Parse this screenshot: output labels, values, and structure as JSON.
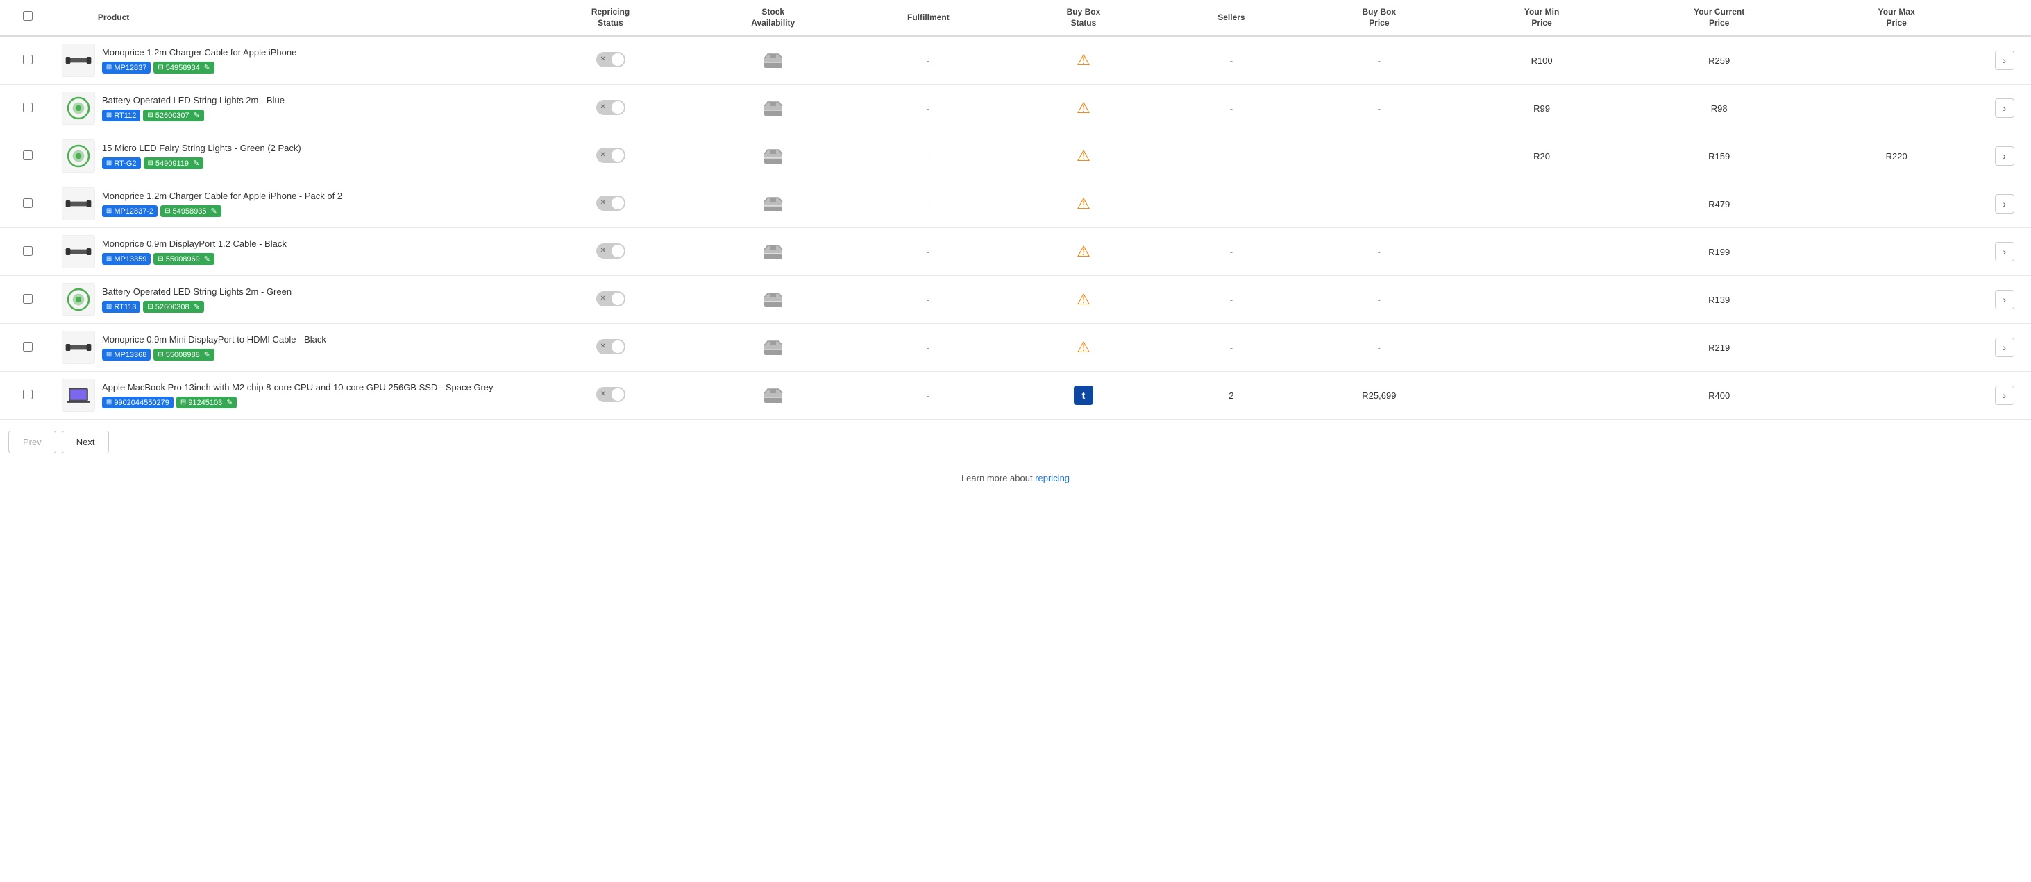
{
  "table": {
    "columns": [
      {
        "id": "checkbox",
        "label": ""
      },
      {
        "id": "product",
        "label": "Product"
      },
      {
        "id": "repricing_status",
        "label": "Repricing Status"
      },
      {
        "id": "stock_availability",
        "label": "Stock Availability"
      },
      {
        "id": "fulfillment",
        "label": "Fulfillment"
      },
      {
        "id": "buybox_status",
        "label": "Buy Box Status"
      },
      {
        "id": "sellers",
        "label": "Sellers"
      },
      {
        "id": "buybox_price",
        "label": "Buy Box Price"
      },
      {
        "id": "your_min_price",
        "label": "Your Min Price"
      },
      {
        "id": "your_current_price",
        "label": "Your Current Price"
      },
      {
        "id": "your_max_price",
        "label": "Your Max Price"
      },
      {
        "id": "action",
        "label": ""
      }
    ],
    "rows": [
      {
        "id": 1,
        "name": "Monoprice 1.2m Charger Cable for Apple iPhone",
        "tags": [
          {
            "label": "MP12837",
            "color": "blue"
          },
          {
            "label": "54958934",
            "color": "green"
          }
        ],
        "repricing": false,
        "stock": "unavailable",
        "fulfillment": "-",
        "buybox_status": "warning",
        "sellers": "-",
        "buybox_price": "-",
        "min_price": "R100",
        "current_price": "R259",
        "max_price": ""
      },
      {
        "id": 2,
        "name": "Battery Operated LED String Lights 2m - Blue",
        "tags": [
          {
            "label": "RT112",
            "color": "blue"
          },
          {
            "label": "52600307",
            "color": "green"
          }
        ],
        "repricing": false,
        "stock": "unavailable",
        "fulfillment": "-",
        "buybox_status": "warning",
        "sellers": "-",
        "buybox_price": "-",
        "min_price": "R99",
        "current_price": "R98",
        "max_price": ""
      },
      {
        "id": 3,
        "name": "15 Micro LED Fairy String Lights - Green (2 Pack)",
        "tags": [
          {
            "label": "RT-G2",
            "color": "blue"
          },
          {
            "label": "54909119",
            "color": "green"
          }
        ],
        "repricing": false,
        "stock": "unavailable",
        "fulfillment": "-",
        "buybox_status": "warning",
        "sellers": "-",
        "buybox_price": "-",
        "min_price": "R20",
        "current_price": "R159",
        "max_price": "R220"
      },
      {
        "id": 4,
        "name": "Monoprice 1.2m Charger Cable for Apple iPhone - Pack of 2",
        "tags": [
          {
            "label": "MP12837-2",
            "color": "blue"
          },
          {
            "label": "54958935",
            "color": "green"
          }
        ],
        "repricing": false,
        "stock": "unavailable",
        "fulfillment": "-",
        "buybox_status": "warning",
        "sellers": "-",
        "buybox_price": "-",
        "min_price": "",
        "current_price": "R479",
        "max_price": ""
      },
      {
        "id": 5,
        "name": "Monoprice 0.9m DisplayPort 1.2 Cable - Black",
        "tags": [
          {
            "label": "MP13359",
            "color": "blue"
          },
          {
            "label": "55008969",
            "color": "green"
          }
        ],
        "repricing": false,
        "stock": "unavailable",
        "fulfillment": "-",
        "buybox_status": "warning",
        "sellers": "-",
        "buybox_price": "-",
        "min_price": "",
        "current_price": "R199",
        "max_price": ""
      },
      {
        "id": 6,
        "name": "Battery Operated LED String Lights 2m - Green",
        "tags": [
          {
            "label": "RT113",
            "color": "blue"
          },
          {
            "label": "52600308",
            "color": "green"
          }
        ],
        "repricing": false,
        "stock": "unavailable",
        "fulfillment": "-",
        "buybox_status": "warning",
        "sellers": "-",
        "buybox_price": "-",
        "min_price": "",
        "current_price": "R139",
        "max_price": ""
      },
      {
        "id": 7,
        "name": "Monoprice 0.9m Mini DisplayPort to HDMI Cable - Black",
        "tags": [
          {
            "label": "MP13368",
            "color": "blue"
          },
          {
            "label": "55008988",
            "color": "green"
          }
        ],
        "repricing": false,
        "stock": "unavailable",
        "fulfillment": "-",
        "buybox_status": "warning",
        "sellers": "-",
        "buybox_price": "-",
        "min_price": "",
        "current_price": "R219",
        "max_price": ""
      },
      {
        "id": 8,
        "name": "Apple MacBook Pro 13inch with M2 chip 8-core CPU and 10-core GPU 256GB SSD - Space Grey",
        "tags": [
          {
            "label": "9902044550279",
            "color": "blue"
          },
          {
            "label": "91245103",
            "color": "green"
          }
        ],
        "repricing": false,
        "stock": "unavailable",
        "fulfillment": "-",
        "buybox_status": "takealot",
        "sellers": "2",
        "buybox_price": "R25,699",
        "min_price": "",
        "current_price": "R400",
        "max_price": ""
      }
    ]
  },
  "pagination": {
    "prev_label": "Prev",
    "next_label": "Next"
  },
  "footer": {
    "text": "Learn more about ",
    "link_label": "repricing",
    "link_href": "#"
  }
}
